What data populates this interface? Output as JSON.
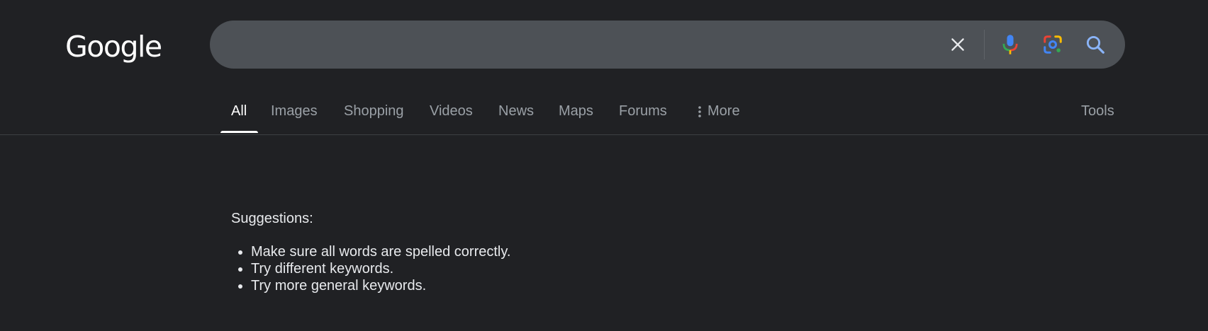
{
  "header": {
    "logo_text": "Google",
    "search": {
      "value": "",
      "placeholder": ""
    },
    "icons": {
      "clear": "close-icon",
      "mic": "microphone-icon",
      "lens": "lens-icon",
      "search": "search-icon"
    }
  },
  "tabs": [
    {
      "label": "All",
      "active": true
    },
    {
      "label": "Images"
    },
    {
      "label": "Shopping"
    },
    {
      "label": "Videos"
    },
    {
      "label": "News"
    },
    {
      "label": "Maps"
    },
    {
      "label": "Forums"
    },
    {
      "label": "More"
    }
  ],
  "tools_label": "Tools",
  "suggestions": {
    "title": "Suggestions:",
    "items": [
      "Make sure all words are spelled correctly.",
      "Try different keywords.",
      "Try more general keywords."
    ]
  },
  "colors": {
    "background": "#202124",
    "searchbar": "#4d5156",
    "mic_blue": "#4285f4",
    "mic_red": "#ea4335",
    "mic_yellow": "#fbbc04",
    "mic_green": "#34a853",
    "search_icon": "#8ab4f8"
  }
}
